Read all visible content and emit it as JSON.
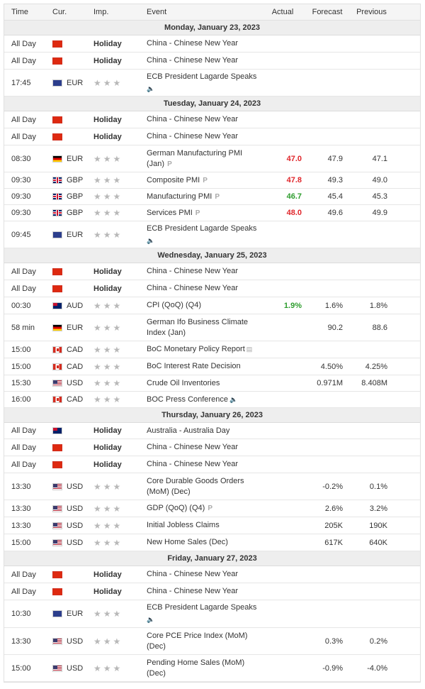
{
  "header": {
    "time": "Time",
    "cur": "Cur.",
    "imp": "Imp.",
    "event": "Event",
    "actual": "Actual",
    "forecast": "Forecast",
    "previous": "Previous"
  },
  "days": [
    {
      "label": "Monday, January 23, 2023",
      "rows": [
        {
          "time": "All Day",
          "flag": "cn",
          "cur": "",
          "imp": "Holiday",
          "event": "China - Chinese New Year",
          "h": 24
        },
        {
          "time": "All Day",
          "flag": "cn",
          "cur": "",
          "imp": "Holiday",
          "event": "China - Chinese New Year",
          "h": 24
        },
        {
          "time": "17:45",
          "flag": "eu",
          "cur": "EUR",
          "imp": "stars",
          "event": "ECB President Lagarde Speaks",
          "icon": "speaker-icon",
          "icon_on_newline": true,
          "h": 38
        }
      ]
    },
    {
      "label": "Tuesday, January 24, 2023",
      "rows": [
        {
          "time": "All Day",
          "flag": "cn",
          "cur": "",
          "imp": "Holiday",
          "event": "China - Chinese New Year",
          "h": 24
        },
        {
          "time": "All Day",
          "flag": "cn",
          "cur": "",
          "imp": "Holiday",
          "event": "China - Chinese New Year",
          "h": 24
        },
        {
          "time": "08:30",
          "flag": "de",
          "cur": "EUR",
          "imp": "stars",
          "event": "German Manufacturing PMI",
          "event2": "(Jan)",
          "badge": "P",
          "actual": "47.0",
          "actual_color": "red",
          "forecast": "47.9",
          "previous": "47.1",
          "h": 38
        },
        {
          "time": "09:30",
          "flag": "gb",
          "cur": "GBP",
          "imp": "stars",
          "event": "Composite PMI",
          "badge": "P",
          "actual": "47.8",
          "actual_color": "red",
          "forecast": "49.3",
          "previous": "49.0",
          "h": 23
        },
        {
          "time": "09:30",
          "flag": "gb",
          "cur": "GBP",
          "imp": "stars",
          "event": "Manufacturing PMI",
          "badge": "P",
          "actual": "46.7",
          "actual_color": "green",
          "forecast": "45.4",
          "previous": "45.3",
          "h": 23
        },
        {
          "time": "09:30",
          "flag": "gb",
          "cur": "GBP",
          "imp": "stars",
          "event": "Services PMI",
          "badge": "P",
          "actual": "48.0",
          "actual_color": "red",
          "forecast": "49.6",
          "previous": "49.9",
          "h": 23
        },
        {
          "time": "09:45",
          "flag": "eu",
          "cur": "EUR",
          "imp": "stars",
          "event": "ECB President Lagarde Speaks",
          "icon": "speaker-icon",
          "icon_on_newline": true,
          "h": 38
        }
      ]
    },
    {
      "label": "Wednesday, January 25, 2023",
      "rows": [
        {
          "time": "All Day",
          "flag": "cn",
          "cur": "",
          "imp": "Holiday",
          "event": "China - Chinese New Year",
          "h": 24
        },
        {
          "time": "All Day",
          "flag": "cn",
          "cur": "",
          "imp": "Holiday",
          "event": "China - Chinese New Year",
          "h": 24
        },
        {
          "time": "00:30",
          "flag": "au",
          "cur": "AUD",
          "imp": "stars",
          "event": "CPI (QoQ) (Q4)",
          "actual": "1.9%",
          "actual_color": "green",
          "forecast": "1.6%",
          "previous": "1.8%",
          "h": 24
        },
        {
          "time": "58 min",
          "flag": "de",
          "cur": "EUR",
          "imp": "stars",
          "event": "German Ifo Business Climate",
          "event2": "Index (Jan)",
          "forecast": "90.2",
          "previous": "88.6",
          "h": 38
        },
        {
          "time": "15:00",
          "flag": "ca",
          "cur": "CAD",
          "imp": "stars",
          "event": "BoC Monetary Policy Report",
          "icon": "document-icon",
          "h": 24
        },
        {
          "time": "15:00",
          "flag": "ca",
          "cur": "CAD",
          "imp": "stars",
          "event": "BoC Interest Rate Decision",
          "forecast": "4.50%",
          "previous": "4.25%",
          "h": 24
        },
        {
          "time": "15:30",
          "flag": "us",
          "cur": "USD",
          "imp": "stars",
          "event": "Crude Oil Inventories",
          "forecast": "0.971M",
          "previous": "8.408M",
          "h": 23
        },
        {
          "time": "16:00",
          "flag": "ca",
          "cur": "CAD",
          "imp": "stars",
          "event": "BOC Press Conference",
          "icon": "speaker-icon",
          "h": 23
        }
      ]
    },
    {
      "label": "Thursday, January 26, 2023",
      "rows": [
        {
          "time": "All Day",
          "flag": "au",
          "cur": "",
          "imp": "Holiday",
          "event": "Australia - Australia Day",
          "h": 23
        },
        {
          "time": "All Day",
          "flag": "cn",
          "cur": "",
          "imp": "Holiday",
          "event": "China - Chinese New Year",
          "h": 24
        },
        {
          "time": "All Day",
          "flag": "cn",
          "cur": "",
          "imp": "Holiday",
          "event": "China - Chinese New Year",
          "h": 24
        },
        {
          "time": "13:30",
          "flag": "us",
          "cur": "USD",
          "imp": "stars",
          "event": "Core Durable Goods Orders",
          "event2": "(MoM) (Dec)",
          "forecast": "-0.2%",
          "previous": "0.1%",
          "h": 38
        },
        {
          "time": "13:30",
          "flag": "us",
          "cur": "USD",
          "imp": "stars",
          "event": "GDP (QoQ) (Q4)",
          "badge": "P",
          "forecast": "2.6%",
          "previous": "3.2%",
          "h": 24
        },
        {
          "time": "13:30",
          "flag": "us",
          "cur": "USD",
          "imp": "stars",
          "event": "Initial Jobless Claims",
          "forecast": "205K",
          "previous": "190K",
          "h": 24
        },
        {
          "time": "15:00",
          "flag": "us",
          "cur": "USD",
          "imp": "stars",
          "event": "New Home Sales (Dec)",
          "forecast": "617K",
          "previous": "640K",
          "h": 24
        }
      ]
    },
    {
      "label": "Friday, January 27, 2023",
      "rows": [
        {
          "time": "All Day",
          "flag": "cn",
          "cur": "",
          "imp": "Holiday",
          "event": "China - Chinese New Year",
          "h": 24
        },
        {
          "time": "All Day",
          "flag": "cn",
          "cur": "",
          "imp": "Holiday",
          "event": "China - Chinese New Year",
          "h": 24
        },
        {
          "time": "10:30",
          "flag": "eu",
          "cur": "EUR",
          "imp": "stars",
          "event": "ECB President Lagarde Speaks",
          "icon": "speaker-icon",
          "icon_on_newline": true,
          "h": 39
        },
        {
          "time": "13:30",
          "flag": "us",
          "cur": "USD",
          "imp": "stars",
          "event": "Core PCE Price Index (MoM)",
          "event2": "(Dec)",
          "forecast": "0.3%",
          "previous": "0.2%",
          "h": 38
        },
        {
          "time": "15:00",
          "flag": "us",
          "cur": "USD",
          "imp": "stars",
          "event": "Pending Home Sales (MoM)",
          "event2": "(Dec)",
          "forecast": "-0.9%",
          "previous": "-4.0%",
          "h": 38
        }
      ]
    }
  ]
}
